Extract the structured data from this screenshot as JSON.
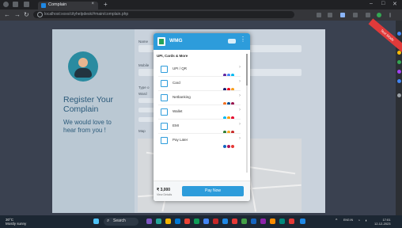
{
  "browser": {
    "tab_title": "Complain",
    "new_tab": "+",
    "url": "localhost:xxxx/cityhelpdesk/#main/complain.php",
    "window_controls": [
      "–",
      "□",
      "✕"
    ]
  },
  "page": {
    "left_heading_line1": "Register Your",
    "left_heading_line2": "Complain",
    "left_sub_line1": "We would love to",
    "left_sub_line2": "hear from you !",
    "form_labels": [
      "Name",
      "Mobile",
      "Type o",
      "Ward",
      "Map"
    ],
    "ribbon_text": "Test Mode"
  },
  "modal": {
    "brand": "WMG",
    "section_title": "UPI, Cards & More",
    "options": [
      {
        "label": "UPI / QR",
        "icon": "upi-icon"
      },
      {
        "label": "Card",
        "icon": "card-icon"
      },
      {
        "label": "Netbanking",
        "icon": "bank-icon"
      },
      {
        "label": "Wallet",
        "icon": "wallet-icon"
      },
      {
        "label": "EMI",
        "icon": "emi-icon"
      },
      {
        "label": "Pay Later",
        "icon": "paylater-icon"
      }
    ],
    "amount": "₹ 3,000",
    "amount_sub": "View Details",
    "pay_button": "Pay Now"
  },
  "taskbar": {
    "weather_temp": "30°C",
    "weather_desc": "Mostly sunny",
    "search_label": "Search",
    "time": "17:01",
    "date": "12-12-2023",
    "lang": "ENG IN"
  }
}
